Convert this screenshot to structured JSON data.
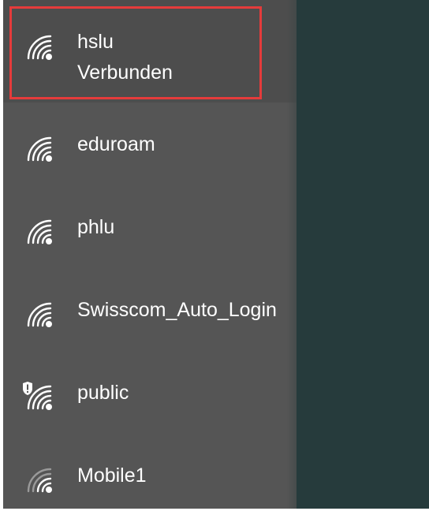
{
  "networks": [
    {
      "ssid": "hslu",
      "status": "Verbunden",
      "icon": "wifi-signal-icon",
      "selected": true,
      "secured_warning": false
    },
    {
      "ssid": "eduroam",
      "icon": "wifi-signal-icon",
      "selected": false,
      "secured_warning": false
    },
    {
      "ssid": "phlu",
      "icon": "wifi-signal-icon",
      "selected": false,
      "secured_warning": false
    },
    {
      "ssid": "Swisscom_Auto_Login",
      "icon": "wifi-signal-icon",
      "selected": false,
      "secured_warning": false
    },
    {
      "ssid": "public",
      "icon": "wifi-open-warning-icon",
      "selected": false,
      "secured_warning": true
    },
    {
      "ssid": "Mobile1",
      "icon": "wifi-weak-signal-icon",
      "selected": false,
      "secured_warning": false
    }
  ],
  "colors": {
    "list_background": "#555555",
    "selected_background": "#4d4d4d",
    "desktop_background": "#263b3c",
    "highlight_border": "#e53b3b",
    "text": "#ffffff"
  }
}
